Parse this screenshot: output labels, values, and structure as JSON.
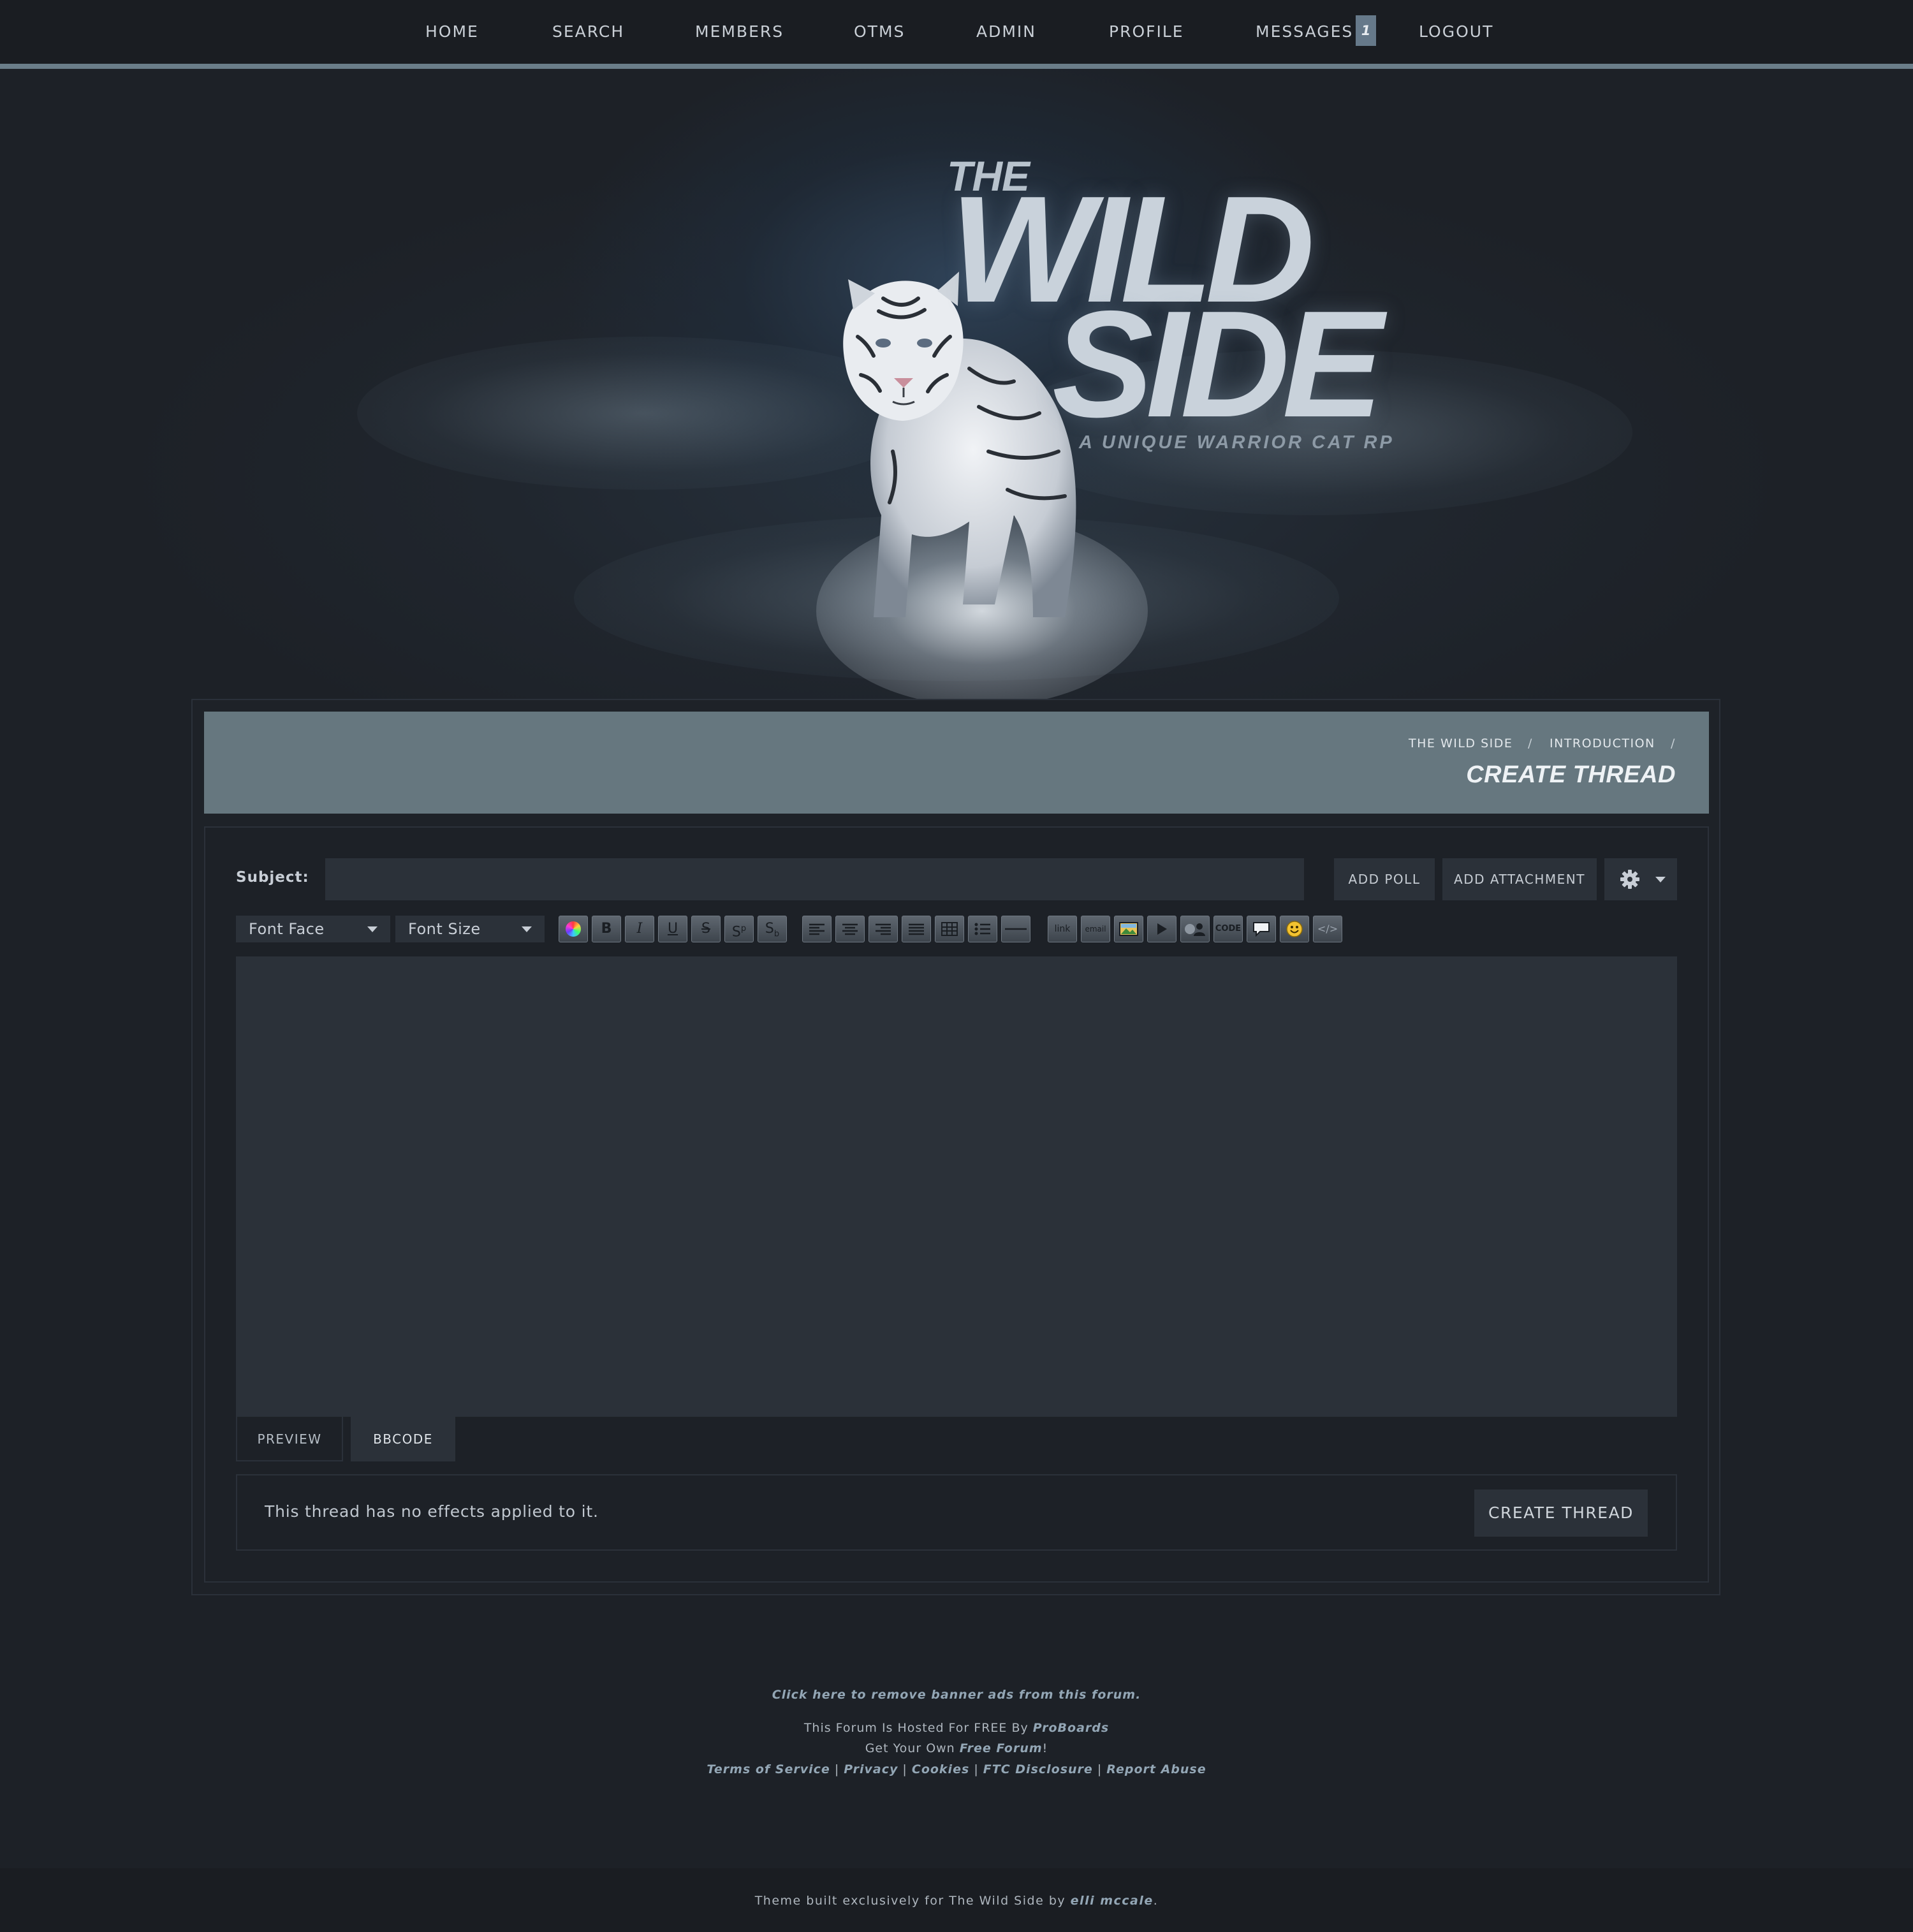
{
  "nav": {
    "items": [
      "HOME",
      "SEARCH",
      "MEMBERS",
      "OTMS",
      "ADMIN",
      "PROFILE",
      "MESSAGES",
      "LOGOUT"
    ],
    "messages_badge": "1"
  },
  "banner": {
    "logo_the": "THE",
    "logo_wild": "WILD",
    "logo_side": "SIDE",
    "tagline": "A UNIQUE WARRIOR CAT RP"
  },
  "breadcrumb": {
    "items": [
      "THE WILD SIDE",
      "INTRODUCTION"
    ],
    "separator": "/"
  },
  "page_title": "CREATE THREAD",
  "form": {
    "subject_label": "Subject:",
    "subject_value": "",
    "add_poll": "ADD POLL",
    "add_attachment": "ADD ATTACHMENT",
    "font_face": "Font Face",
    "font_size": "Font Size",
    "toolbar_icons": [
      "color-icon",
      "bold-icon",
      "italic-icon",
      "underline-icon",
      "strikethrough-icon",
      "superscript-icon",
      "subscript-icon",
      "align-left-icon",
      "align-center-icon",
      "align-right-icon",
      "justify-icon",
      "table-icon",
      "list-icon",
      "horizontal-rule-icon",
      "link-icon",
      "email-icon",
      "image-icon",
      "video-icon",
      "user-icon",
      "code-icon",
      "quote-icon",
      "emoji-icon",
      "source-icon"
    ],
    "toolbar_text": {
      "bold": "B",
      "italic": "I",
      "underline": "U",
      "strike": "S",
      "link": "link",
      "email": "email",
      "code": "CODE",
      "source": "</>"
    },
    "body_value": "",
    "tab_preview": "PREVIEW",
    "tab_bbcode": "BBCODE",
    "effects_text": "This thread has no effects applied to it.",
    "submit": "CREATE THREAD"
  },
  "footer": {
    "remove_ads": "Click here to remove banner ads from this forum.",
    "hosted_prefix": "This Forum Is Hosted For FREE By ",
    "hosted_link": "ProBoards",
    "own_prefix": "Get Your Own ",
    "own_link": "Free Forum",
    "own_suffix": "!",
    "links": [
      "Terms of Service",
      "Privacy",
      "Cookies",
      "FTC Disclosure",
      "Report Abuse"
    ],
    "link_separator": "|",
    "credit_prefix": "Theme built exclusively for The Wild Side by ",
    "credit_author": "elli mccale",
    "credit_suffix": "."
  },
  "colors": {
    "background": "#1d2127",
    "nav_accent": "#6a7d89",
    "header_bar": "#66777f",
    "field": "#2b3139",
    "link": "#93a6b5"
  }
}
